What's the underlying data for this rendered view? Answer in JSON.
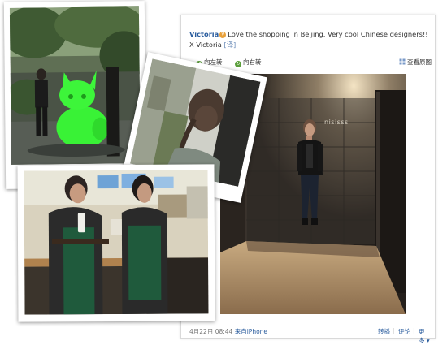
{
  "post": {
    "author": "Victoria",
    "verified_badge": "V",
    "text": "Love the shopping in Beijing. Very cool Chinese designers!! X Victoria",
    "translate_label": "[译]"
  },
  "image_toolbar": {
    "rotate_left": "向左转",
    "rotate_right": "向右转",
    "view_original": "查看原图"
  },
  "footer": {
    "date": "4月22日 08:44",
    "source": "来自iPhone",
    "repost": "转播",
    "comment": "评论",
    "more": "更多"
  },
  "photo_signage": {
    "shop_sign": "nisisss"
  },
  "colors": {
    "link": "#2b5d9e",
    "green_figure": "#39f236",
    "apron": "#1f5a3c"
  }
}
